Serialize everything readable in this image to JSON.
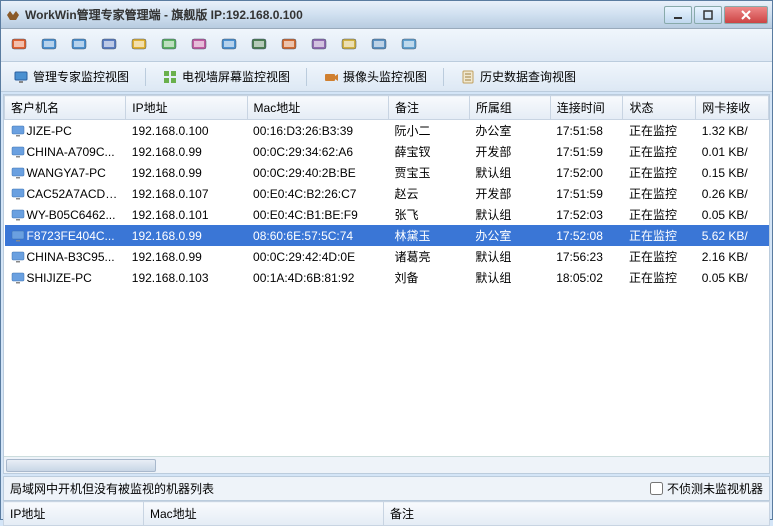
{
  "window": {
    "title": "WorkWin管理专家管理端 - 旗舰版 IP:192.168.0.100"
  },
  "tabs": [
    {
      "label": "管理专家监控视图"
    },
    {
      "label": "电视墙屏幕监控视图"
    },
    {
      "label": "摄像头监控视图"
    },
    {
      "label": "历史数据查询视图"
    }
  ],
  "columns": {
    "name": "客户机名",
    "ip": "IP地址",
    "mac": "Mac地址",
    "note": "备注",
    "group": "所属组",
    "time": "连接时间",
    "status": "状态",
    "net": "网卡接收"
  },
  "rows": [
    {
      "name": "JIZE-PC",
      "ip": "192.168.0.100",
      "mac": "00:16:D3:26:B3:39",
      "note": "阮小二",
      "group": "办公室",
      "time": "17:51:58",
      "status": "正在监控",
      "net": "1.32 KB/",
      "selected": false
    },
    {
      "name": "CHINA-A709C...",
      "ip": "192.168.0.99",
      "mac": "00:0C:29:34:62:A6",
      "note": "薛宝钗",
      "group": "开发部",
      "time": "17:51:59",
      "status": "正在监控",
      "net": "0.01 KB/",
      "selected": false
    },
    {
      "name": "WANGYA7-PC",
      "ip": "192.168.0.99",
      "mac": "00:0C:29:40:2B:BE",
      "note": "贾宝玉",
      "group": "默认组",
      "time": "17:52:00",
      "status": "正在监控",
      "net": "0.15 KB/",
      "selected": false
    },
    {
      "name": "CAC52A7ACD7...",
      "ip": "192.168.0.107",
      "mac": "00:E0:4C:B2:26:C7",
      "note": "赵云",
      "group": "开发部",
      "time": "17:51:59",
      "status": "正在监控",
      "net": "0.26 KB/",
      "selected": false
    },
    {
      "name": "WY-B05C6462...",
      "ip": "192.168.0.101",
      "mac": "00:E0:4C:B1:BE:F9",
      "note": "张飞",
      "group": "默认组",
      "time": "17:52:03",
      "status": "正在监控",
      "net": "0.05 KB/",
      "selected": false
    },
    {
      "name": "F8723FE404C...",
      "ip": "192.168.0.99",
      "mac": "08:60:6E:57:5C:74",
      "note": "林黛玉",
      "group": "办公室",
      "time": "17:52:08",
      "status": "正在监控",
      "net": "5.62 KB/",
      "selected": true
    },
    {
      "name": "CHINA-B3C95...",
      "ip": "192.168.0.99",
      "mac": "00:0C:29:42:4D:0E",
      "note": "诸葛亮",
      "group": "默认组",
      "time": "17:56:23",
      "status": "正在监控",
      "net": "2.16 KB/",
      "selected": false
    },
    {
      "name": "SHIJIZE-PC",
      "ip": "192.168.0.103",
      "mac": "00:1A:4D:6B:81:92",
      "note": "刘备",
      "group": "默认组",
      "time": "18:05:02",
      "status": "正在监控",
      "net": "0.05 KB/",
      "selected": false
    }
  ],
  "bottom": {
    "label": "局域网中开机但没有被监视的机器列表",
    "checkbox": "不侦测未监视机器",
    "cols": {
      "ip": "IP地址",
      "mac": "Mac地址",
      "note": "备注"
    }
  },
  "toolbar_icons": [
    "screenshot-icon",
    "monitor-icon",
    "multi-screen-icon",
    "display-icon",
    "folder-icon",
    "manage-icon",
    "scan-icon",
    "report-icon",
    "globe-icon",
    "capture-icon",
    "camera-icon",
    "doc-icon",
    "user-icon",
    "help-icon"
  ]
}
